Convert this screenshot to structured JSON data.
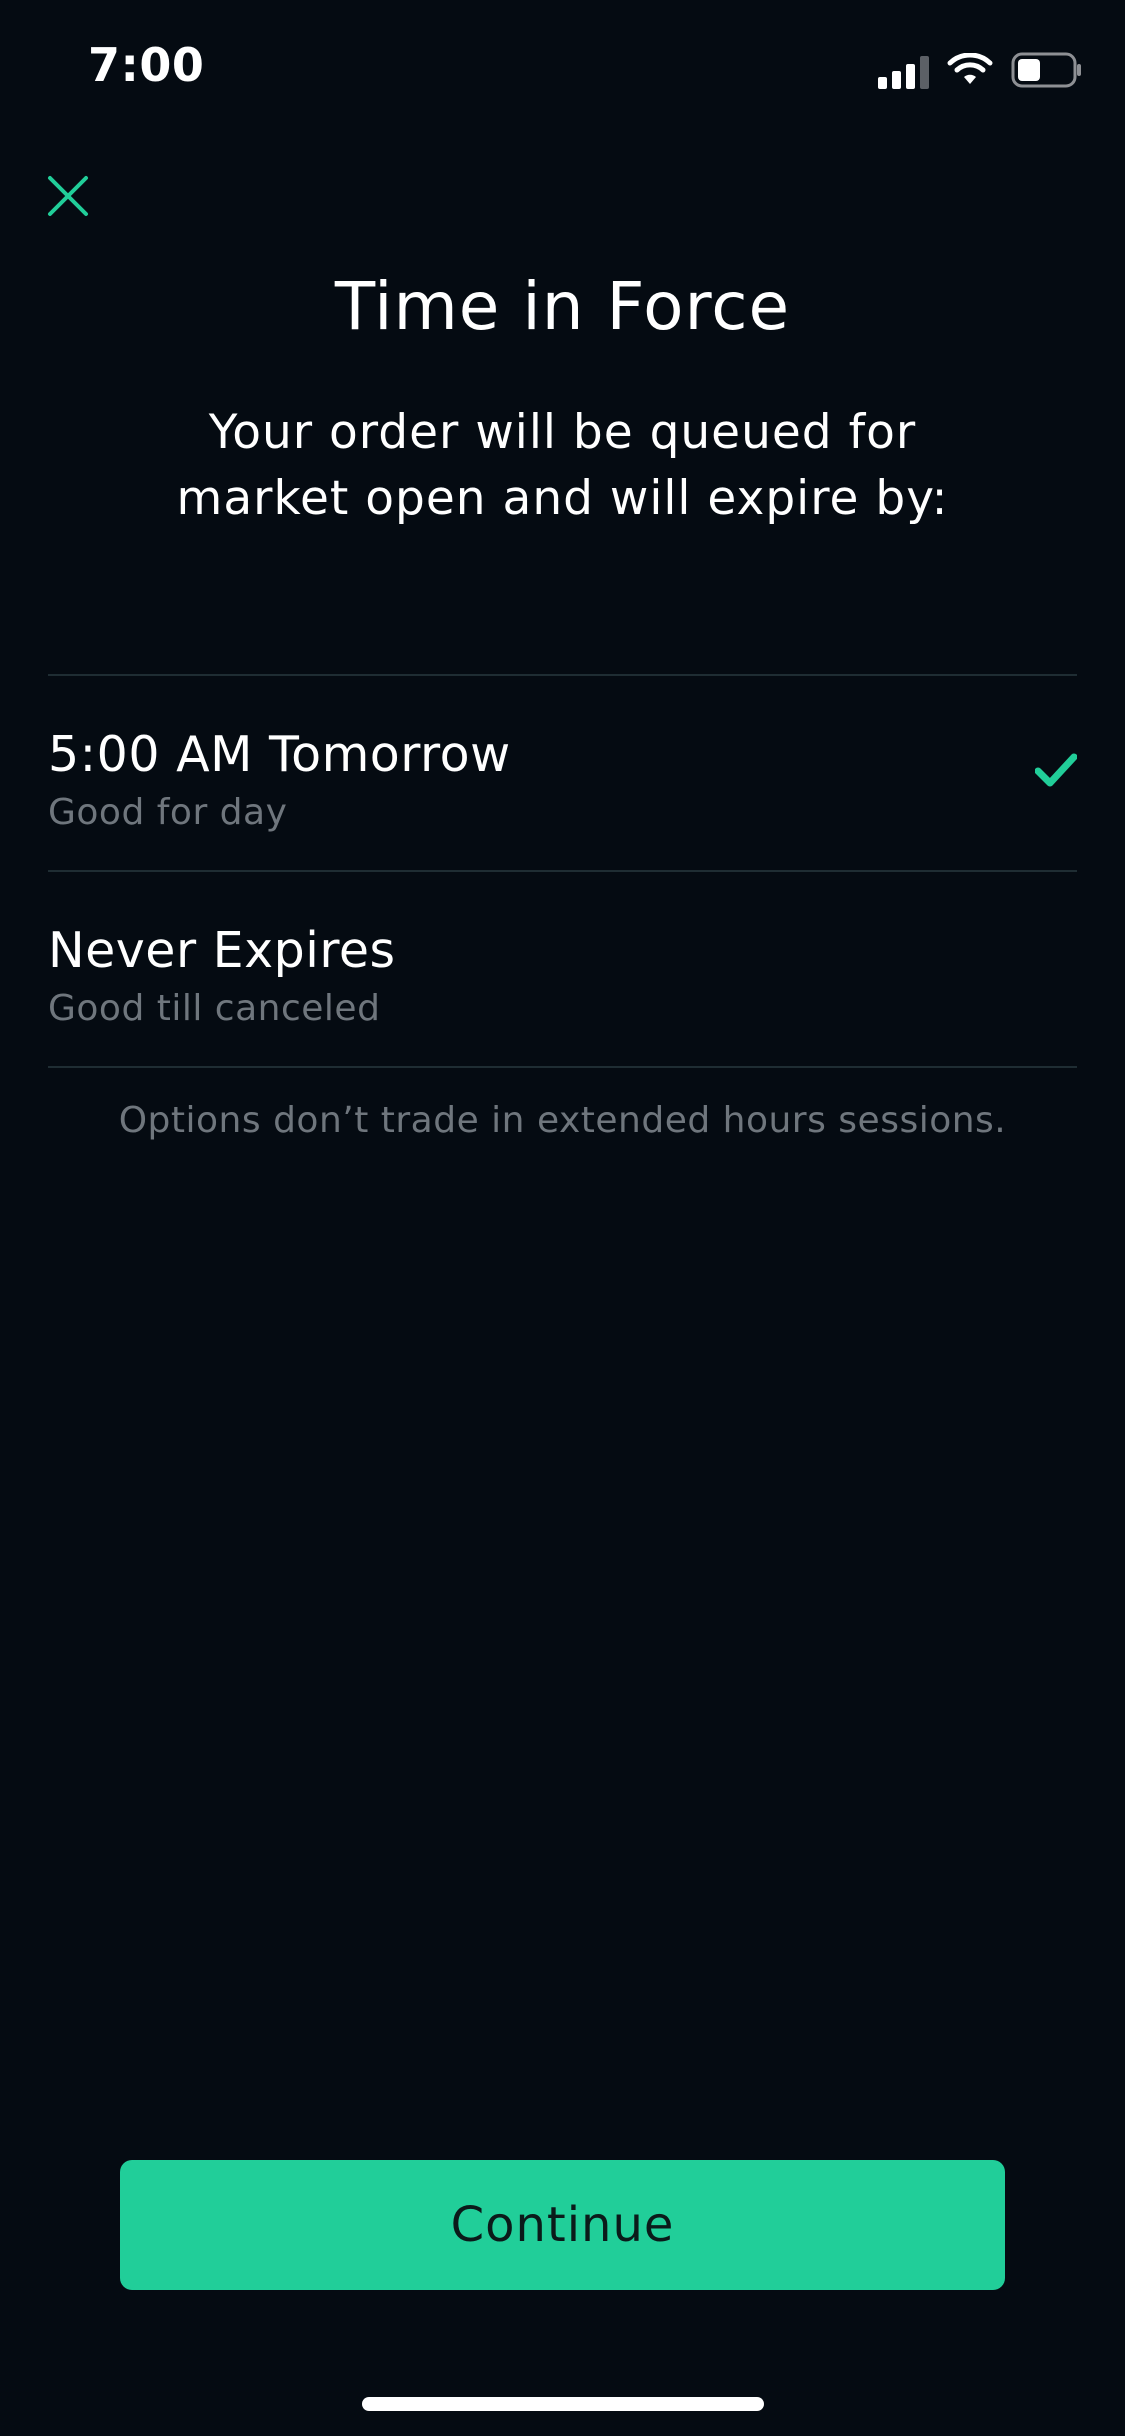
{
  "status_bar": {
    "time": "7:00",
    "icons": [
      "signal-icon",
      "wifi-icon",
      "battery-icon"
    ]
  },
  "header": {
    "close_icon": "close-icon",
    "title": "Time in Force",
    "subtitle": "Your order will be queued for market open and will expire by:"
  },
  "options": [
    {
      "label": "5:00 AM Tomorrow",
      "sublabel": "Good for day",
      "selected": true
    },
    {
      "label": "Never Expires",
      "sublabel": "Good till canceled",
      "selected": false
    }
  ],
  "note": "Options don’t trade in extended hours sessions.",
  "footer": {
    "continue_label": "Continue"
  },
  "colors": {
    "background": "#050b12",
    "accent": "#21ce99",
    "secondary_text": "#6f767d",
    "divider": "#1f2d33"
  }
}
